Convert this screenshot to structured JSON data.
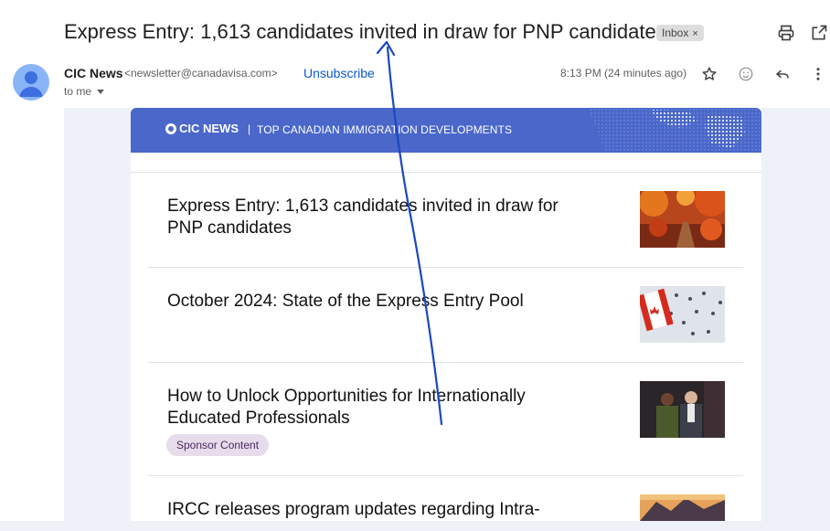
{
  "header": {
    "subject": "Express Entry: 1,613 candidates invited in draw for PNP candidates",
    "label": "Inbox",
    "label_close": "×"
  },
  "sender": {
    "name": "CIC News",
    "email": "<newsletter@canadavisa.com>",
    "unsubscribe": "Unsubscribe",
    "to": "to me",
    "time": "8:13 PM (24 minutes ago)"
  },
  "toolbar_icons": [
    "print-icon",
    "open-in-new-window-icon",
    "star-icon",
    "emoji-icon",
    "reply-icon",
    "more-vert-icon"
  ],
  "newsletter": {
    "logo": "CIC NEWS",
    "separator": "|",
    "tagline": "TOP CANADIAN IMMIGRATION DEVELOPMENTS",
    "articles": [
      {
        "title": "Express Entry: 1,613 candidates invited in draw for PNP candidates"
      },
      {
        "title": "October 2024: State of the Express Entry Pool"
      },
      {
        "title": "How to Unlock Opportunities for Internationally Educated Professionals",
        "badge": "Sponsor Content"
      },
      {
        "title": "IRCC releases program updates regarding Intra-"
      }
    ]
  },
  "colors": {
    "banner": "#4a67c9",
    "link": "#0b57d0",
    "annotation_stroke": "#1a47c4",
    "sponsor_bg": "#e6dceb"
  }
}
